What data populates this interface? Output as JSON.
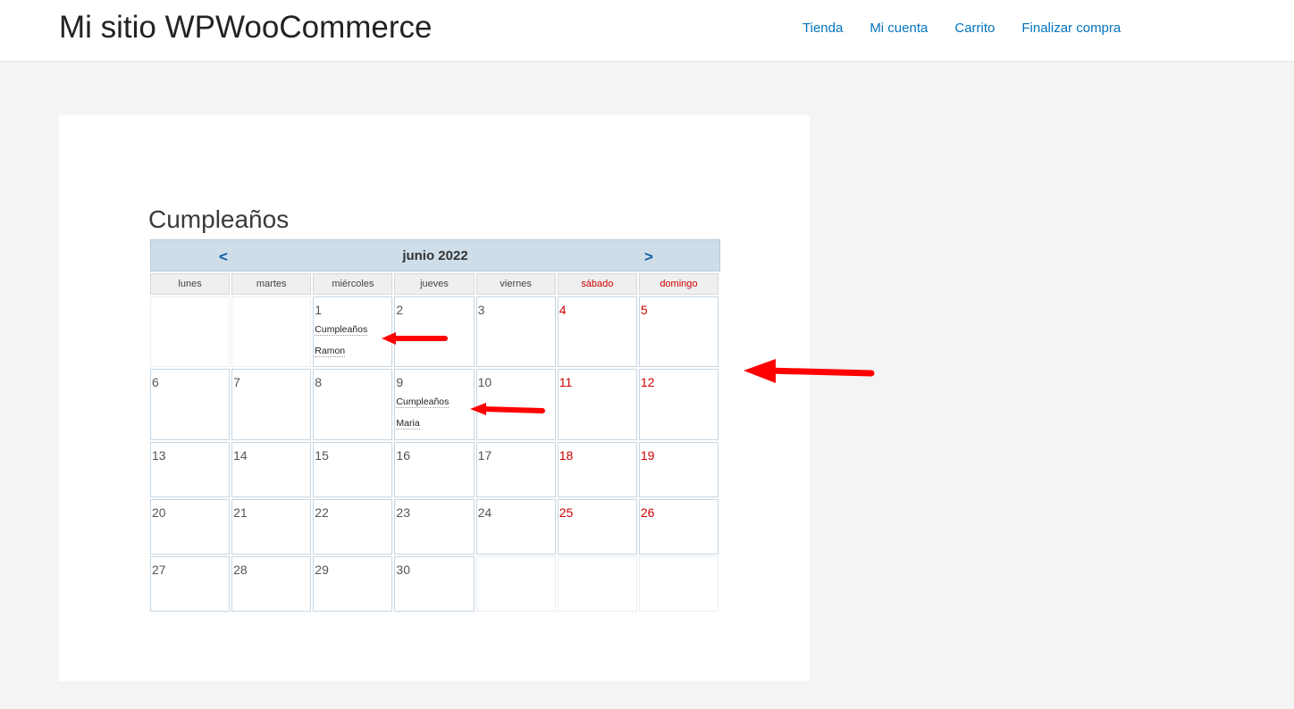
{
  "header": {
    "site_title": "Mi sitio WPWooCommerce",
    "nav": [
      "Tienda",
      "Mi cuenta",
      "Carrito",
      "Finalizar compra"
    ]
  },
  "page": {
    "title": "Cumpleaños"
  },
  "calendar": {
    "month": "junio 2022",
    "prev": "<",
    "next": ">",
    "weekdays": [
      "lunes",
      "martes",
      "miércoles",
      "jueves",
      "viernes",
      "sábado",
      "domingo"
    ],
    "weeks": [
      [
        "",
        "",
        "1",
        "2",
        "3",
        "4",
        "5"
      ],
      [
        "6",
        "7",
        "8",
        "9",
        "10",
        "11",
        "12"
      ],
      [
        "13",
        "14",
        "15",
        "16",
        "17",
        "18",
        "19"
      ],
      [
        "20",
        "21",
        "22",
        "23",
        "24",
        "25",
        "26"
      ],
      [
        "27",
        "28",
        "29",
        "30",
        "",
        "",
        ""
      ]
    ],
    "events": {
      "1": [
        "Cumpleaños",
        "Ramon"
      ],
      "9": [
        "Cumpleaños",
        "Maria"
      ]
    }
  },
  "colors": {
    "link": "#0274be",
    "weekend": "#d00000",
    "header_bar": "#cfdde9",
    "annotation_arrow": "#ff0000"
  }
}
